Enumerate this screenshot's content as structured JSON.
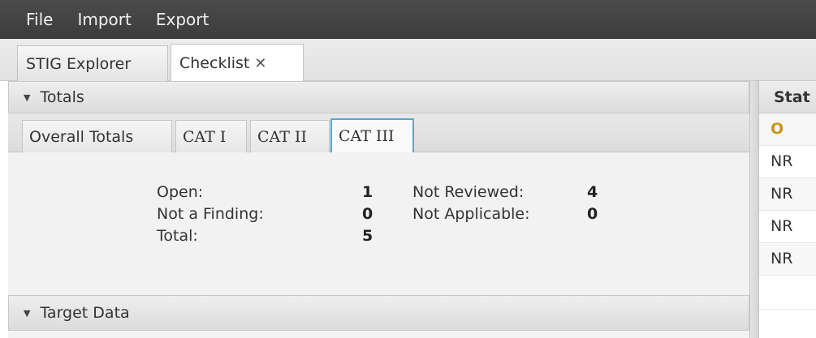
{
  "menubar": {
    "items": [
      "File",
      "Import",
      "Export"
    ]
  },
  "tabs": [
    {
      "label": "STIG Explorer"
    },
    {
      "label": "Checklist",
      "close": "✕"
    }
  ],
  "totals_section": {
    "header": "Totals",
    "subtabs": [
      "Overall Totals",
      "CAT I",
      "CAT II",
      "CAT III"
    ],
    "active_subtab": "CAT III",
    "stats": {
      "open_label": "Open:",
      "open_value": "1",
      "not_finding_label": "Not a Finding:",
      "not_finding_value": "0",
      "total_label": "Total:",
      "total_value": "5",
      "not_reviewed_label": "Not Reviewed:",
      "not_reviewed_value": "4",
      "not_applicable_label": "Not Applicable:",
      "not_applicable_value": "0"
    }
  },
  "target_section": {
    "header": "Target Data"
  },
  "status_column": {
    "header": "Stat",
    "rows": [
      "O",
      "NR",
      "NR",
      "NR",
      "NR",
      ""
    ]
  },
  "colors": {
    "menubar": "#404040",
    "active_tab_border": "#5aa6d6",
    "open_status": "#c8961a"
  }
}
